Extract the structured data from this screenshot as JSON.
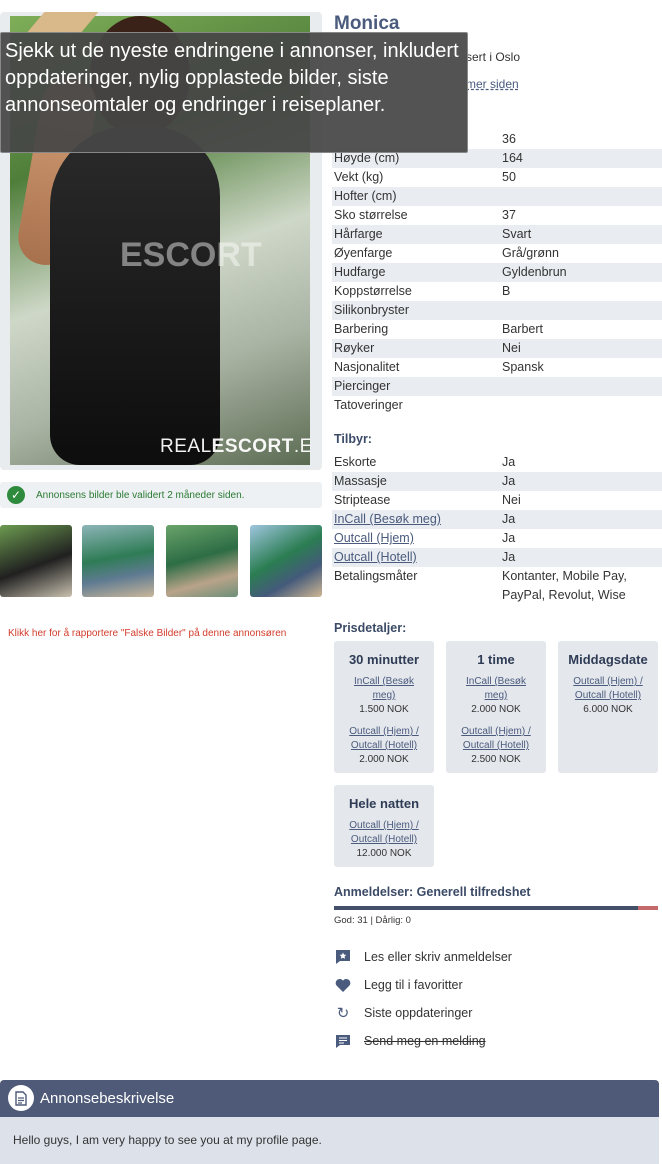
{
  "profile": {
    "name": "Monica",
    "location_fragment": "sert i Oslo",
    "follow_fragment": "mer siden",
    "watermark_brand": "REALESCORT.EU",
    "watermark_part1": "REAL",
    "watermark_part2": "ESCORT",
    "watermark_part3": ".EU"
  },
  "tooltip": {
    "text": "Sjekk ut de nyeste endringene i annonser, inkludert oppdateringer, nylig opplastede bilder, siste annonseomtaler og endringer i reiseplaner."
  },
  "validation": {
    "text": "Annonsens bilder ble validert 2 måneder siden."
  },
  "report_link": "Klikk her for å rapportere \"Falske Bilder\" på denne annonsøren",
  "details": [
    {
      "k": "",
      "v": "36"
    },
    {
      "k": "Høyde (cm)",
      "v": "164"
    },
    {
      "k": "Vekt (kg)",
      "v": "50"
    },
    {
      "k": "Hofter (cm)",
      "v": ""
    },
    {
      "k": "Sko størrelse",
      "v": "37"
    },
    {
      "k": "Hårfarge",
      "v": "Svart"
    },
    {
      "k": "Øyenfarge",
      "v": "Grå/grønn"
    },
    {
      "k": "Hudfarge",
      "v": "Gyldenbrun"
    },
    {
      "k": "Koppstørrelse",
      "v": "B"
    },
    {
      "k": "Silikonbryster",
      "v": ""
    },
    {
      "k": "Barbering",
      "v": "Barbert"
    },
    {
      "k": "Røyker",
      "v": "Nei"
    },
    {
      "k": "Nasjonalitet",
      "v": "Spansk"
    },
    {
      "k": "Piercinger",
      "v": ""
    },
    {
      "k": "Tatoveringer",
      "v": ""
    }
  ],
  "offers_heading": "Tilbyr:",
  "offers": [
    {
      "k": "Eskorte",
      "v": "Ja"
    },
    {
      "k": "Massasje",
      "v": "Ja"
    },
    {
      "k": "Striptease",
      "v": "Nei"
    },
    {
      "k": "InCall (Besøk meg)",
      "v": "Ja"
    },
    {
      "k": "Outcall (Hjem)",
      "v": "Ja"
    },
    {
      "k": "Outcall (Hotell)",
      "v": "Ja"
    },
    {
      "k": "Betalingsmåter",
      "v": "Kontanter, Mobile Pay,",
      "v2": "PayPal, Revolut, Wise"
    }
  ],
  "prices_heading": "Prisdetaljer:",
  "prices": [
    {
      "title": "30 minutter",
      "l1a": "InCall (Besøk",
      "l1b": "meg)",
      "p1": "1.500 NOK",
      "l2a": "Outcall (Hjem) /",
      "l2b": "Outcall (Hotell)",
      "p2": "2.000 NOK"
    },
    {
      "title": "1 time",
      "l1a": "InCall (Besøk",
      "l1b": "meg)",
      "p1": "2.000 NOK",
      "l2a": "Outcall (Hjem) /",
      "l2b": "Outcall (Hotell)",
      "p2": "2.500 NOK"
    },
    {
      "title": "Middagsdate",
      "l1a": "Outcall (Hjem) /",
      "l1b": "Outcall (Hotell)",
      "p1": "6.000 NOK"
    },
    {
      "title": "Hele natten",
      "l1a": "Outcall (Hjem) /",
      "l1b": "Outcall (Hotell)",
      "p1": "12.000 NOK"
    }
  ],
  "reviews": {
    "heading": "Anmeldelser: Generell tilfredshet",
    "counts": "God: 31 | Dårlig: 0",
    "good": 31,
    "bad": 0
  },
  "actions": [
    {
      "icon": "review-icon",
      "label": "Les eller skriv anmeldelser"
    },
    {
      "icon": "heart-icon",
      "label": "Legg til i favoritter"
    },
    {
      "icon": "refresh-icon",
      "label": "Siste oppdateringer"
    },
    {
      "icon": "message-icon",
      "label": "Send meg en melding"
    }
  ],
  "description": {
    "title": "Annonsebeskrivelse",
    "body": "Hello guys, I am very happy to see you at my profile page."
  },
  "colors": {
    "accent": "#4a5b7d",
    "header_bar": "#4e5a78",
    "valid_green": "#2e8b3e",
    "report_red": "#d23c2c"
  }
}
